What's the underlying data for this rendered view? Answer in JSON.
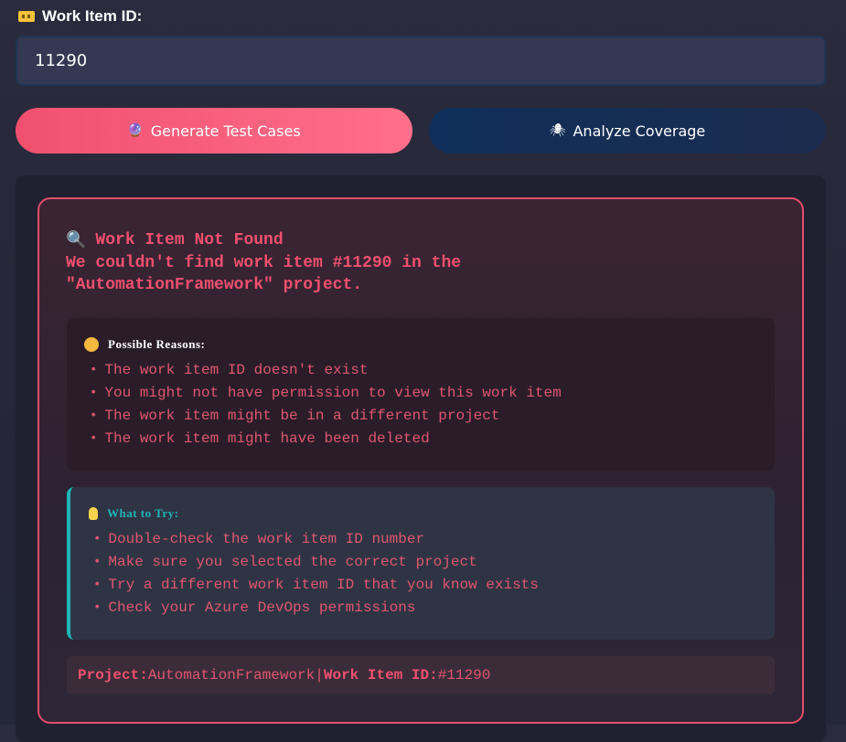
{
  "form": {
    "label": "Work Item ID:",
    "label_icon": "ticket-icon",
    "input_value": "11290"
  },
  "buttons": {
    "generate_label": "Generate Test Cases",
    "generate_icon": "crystal-ball-icon",
    "analyze_label": "Analyze Coverage",
    "analyze_icon": "spider-icon"
  },
  "error": {
    "title": "Work Item Not Found",
    "title_icon": "magnifier-icon",
    "message_line1": "We couldn't find work item #11290 in the",
    "message_line2": "\"AutomationFramework\" project.",
    "reasons_heading": "Possible Reasons:",
    "reasons_icon": "thinking-face-icon",
    "reasons": [
      "The work item ID doesn't exist",
      "You might not have permission to view this work item",
      "The work item might be in a different project",
      "The work item might have been deleted"
    ],
    "tips_heading": "What to Try:",
    "tips_icon": "lightbulb-icon",
    "tips": [
      "Double-check the work item ID number",
      "Make sure you selected the correct project",
      "Try a different work item ID that you know exists",
      "Check your Azure DevOps permissions"
    ],
    "info": {
      "project_label": "Project:",
      "project_value": "AutomationFramework",
      "separator": "|",
      "id_label": "Work Item ID:",
      "id_value": "#11290"
    }
  },
  "colors": {
    "accent_pink": "#f0506e",
    "teal": "#1fb5b8",
    "navy_button": "#0f2f5a"
  }
}
